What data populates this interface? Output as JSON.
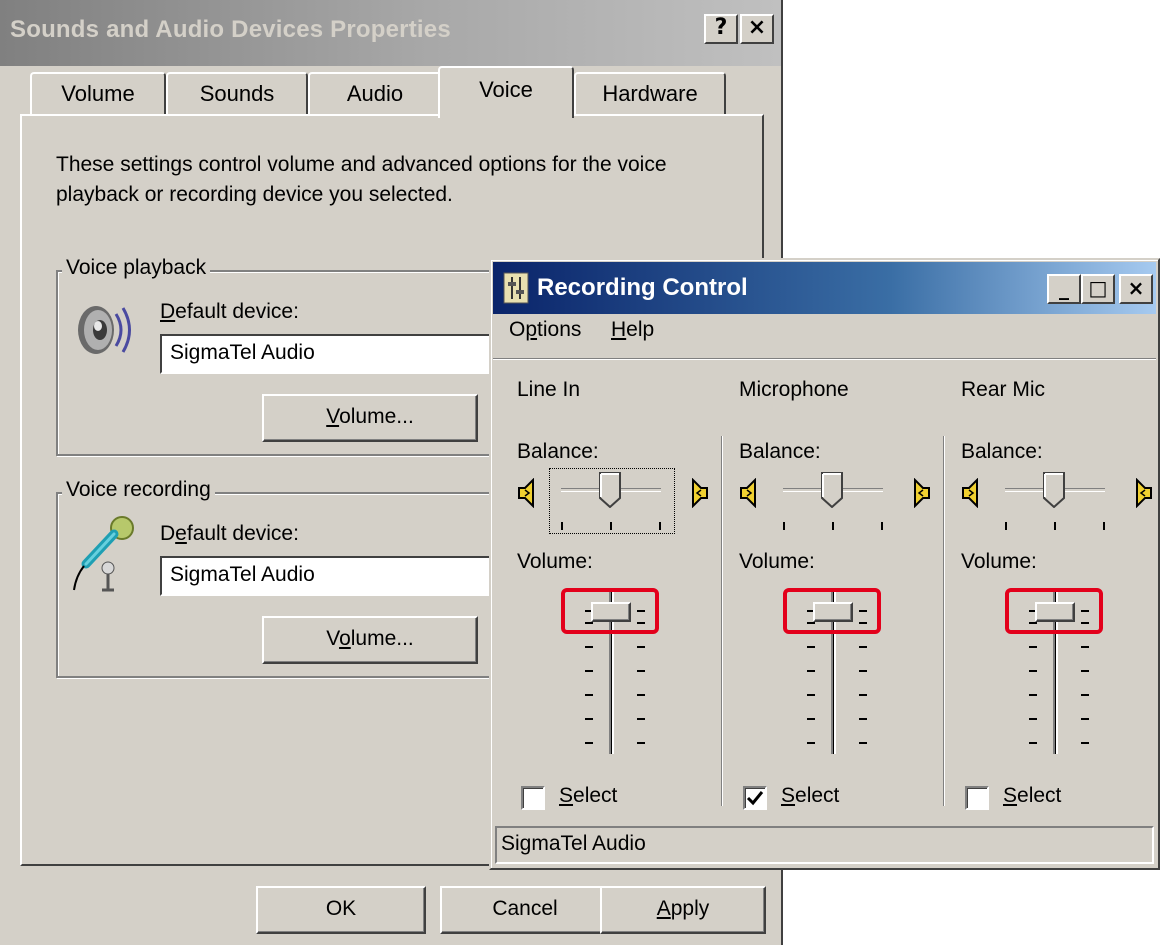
{
  "dialog": {
    "title": "Sounds and Audio Devices Properties",
    "help_button": "?",
    "close_button": "×",
    "tabs": [
      {
        "label": "Volume",
        "active": false
      },
      {
        "label": "Sounds",
        "active": false
      },
      {
        "label": "Audio",
        "active": false
      },
      {
        "label": "Voice",
        "active": true
      },
      {
        "label": "Hardware",
        "active": false
      }
    ],
    "description": "These settings control volume and advanced options for the voice playback or recording device you selected.",
    "playback": {
      "group_label": "Voice playback",
      "default_device_label_pre": "",
      "default_device_label_accel": "D",
      "default_device_label_post": "efault device:",
      "device_value": "SigmaTel Audio",
      "volume_button_accel": "V",
      "volume_button_rest": "olume..."
    },
    "recording": {
      "group_label": "Voice recording",
      "default_device_label_pre": "D",
      "default_device_label_accel": "e",
      "default_device_label_post": "fault device:",
      "device_value": "SigmaTel Audio",
      "volume_button_pre": "V",
      "volume_button_accel": "o",
      "volume_button_rest": "lume..."
    },
    "buttons": {
      "ok": "OK",
      "cancel": "Cancel",
      "apply_accel": "A",
      "apply_rest": "pply"
    }
  },
  "recording_control": {
    "title": "Recording Control",
    "minimize": "_",
    "maximize": "□",
    "close": "×",
    "menu": {
      "options_pre": "O",
      "options_accel": "p",
      "options_post": "tions",
      "help_accel": "H",
      "help_post": "elp"
    },
    "channels": [
      {
        "name": "Line In",
        "balance_label": "Balance:",
        "volume_label": "Volume:",
        "select_accel": "S",
        "select_rest": "elect",
        "selected": false,
        "volume_level": 1.0
      },
      {
        "name": "Microphone",
        "balance_label": "Balance:",
        "volume_label": "Volume:",
        "select_accel": "S",
        "select_rest": "elect",
        "selected": true,
        "volume_level": 1.0
      },
      {
        "name": "Rear Mic",
        "balance_label": "Balance:",
        "volume_label": "Volume:",
        "select_accel": "S",
        "select_rest": "elect",
        "selected": false,
        "volume_level": 1.0
      }
    ],
    "status": "SigmaTel Audio",
    "highlight_color": "#e3001b"
  }
}
